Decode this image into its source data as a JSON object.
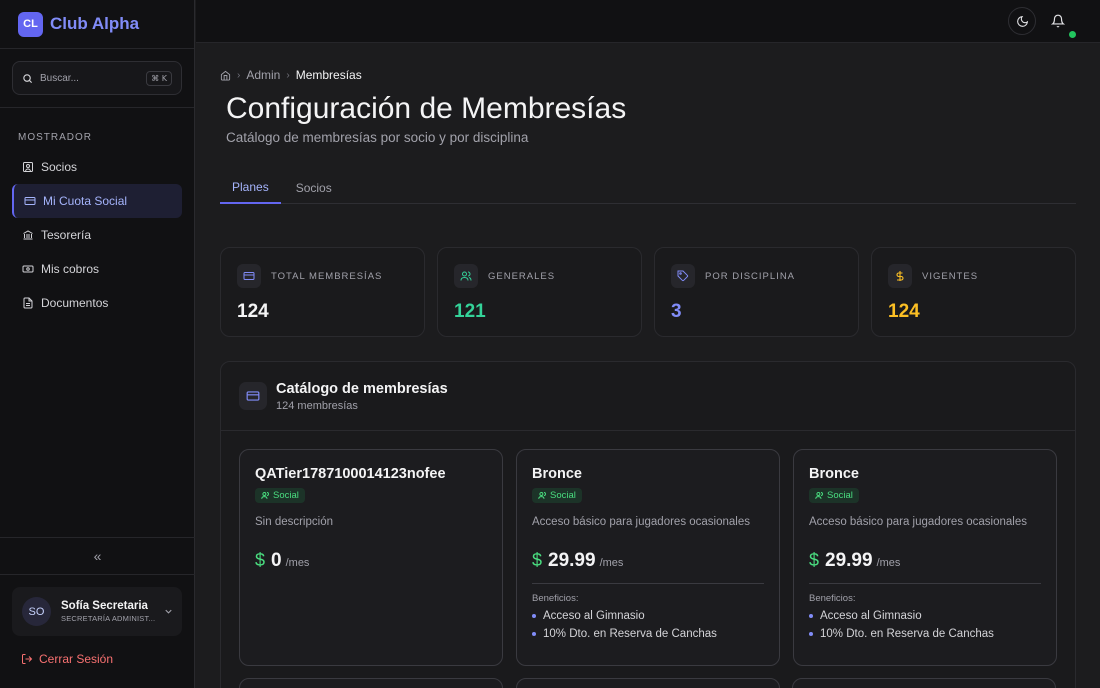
{
  "brand": {
    "logo": "CL",
    "name": "Club Alpha"
  },
  "search": {
    "placeholder": "Buscar...",
    "shortcut": "⌘ K"
  },
  "sidebar": {
    "section": "MOSTRADOR",
    "items": [
      {
        "label": "Socios",
        "icon": "user-square-icon"
      },
      {
        "label": "Mi Cuota Social",
        "icon": "credit-card-icon",
        "active": true
      },
      {
        "label": "Tesorería",
        "icon": "bank-icon"
      },
      {
        "label": "Mis cobros",
        "icon": "money-icon"
      },
      {
        "label": "Documentos",
        "icon": "document-icon"
      }
    ],
    "collapse": "«"
  },
  "user": {
    "initials": "SO",
    "name": "Sofía Secretaria",
    "role": "SECRETARÍA ADMINIST..."
  },
  "logout": "Cerrar Sesión",
  "breadcrumb": {
    "admin": "Admin",
    "current": "Membresías"
  },
  "page": {
    "title": "Configuración de Membresías",
    "subtitle": "Catálogo de membresías por socio y por disciplina"
  },
  "tabs": [
    "Planes",
    "Socios"
  ],
  "stats": [
    {
      "label": "TOTAL MEMBRESÍAS",
      "value": "124",
      "color": "#f4f4f5",
      "icon": "credit-card-icon"
    },
    {
      "label": "GENERALES",
      "value": "121",
      "color": "#34d399",
      "icon": "users-icon"
    },
    {
      "label": "POR DISCIPLINA",
      "value": "3",
      "color": "#818cf8",
      "icon": "tag-icon"
    },
    {
      "label": "VIGENTES",
      "value": "124",
      "color": "#fbbf24",
      "icon": "dollar-icon"
    }
  ],
  "catalog": {
    "title": "Catálogo de membresías",
    "subtitle": "124 membresías"
  },
  "cards": [
    {
      "name": "QATier1787100014123nofee",
      "badge": "Social",
      "desc": "Sin descripción",
      "currency": "$",
      "price": "0",
      "per": "/mes"
    },
    {
      "name": "Bronce",
      "badge": "Social",
      "desc": "Acceso básico para jugadores ocasionales",
      "currency": "$",
      "price": "29.99",
      "per": "/mes",
      "benefits_title": "Beneficios:",
      "benefits": [
        "Acceso al Gimnasio",
        "10% Dto. en Reserva de Canchas"
      ]
    },
    {
      "name": "Bronce",
      "badge": "Social",
      "desc": "Acceso básico para jugadores ocasionales",
      "currency": "$",
      "price": "29.99",
      "per": "/mes",
      "benefits_title": "Beneficios:",
      "benefits": [
        "Acceso al Gimnasio",
        "10% Dto. en Reserva de Canchas"
      ]
    }
  ]
}
